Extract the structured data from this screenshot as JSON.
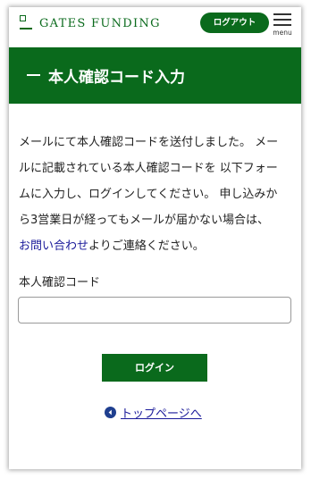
{
  "header": {
    "brand": "GATES FUNDING",
    "logout_label": "ログアウト",
    "menu_label": "menu"
  },
  "title": {
    "prefix": "—",
    "text": "本人確認コード入力"
  },
  "message": {
    "line1": "メールにて本人確認コードを送付しました。 メー",
    "line2": "ルに記載されている本人確認コードを 以下フォー",
    "line3": "ムに入力し、ログインしてください。 申し込みか",
    "line4": "ら3営業日が経ってもメールが届かない場合は、",
    "contact_link": "お問い合わせ",
    "line5_suffix": "よりご連絡ください。"
  },
  "form": {
    "code_label": "本人確認コード",
    "code_value": "",
    "login_label": "ログイン"
  },
  "footer_link": {
    "label": "トップページへ",
    "icon": "back-arrow-circle-icon"
  },
  "colors": {
    "brand_green": "#0a6a1c",
    "link_blue": "#1a1a9a"
  }
}
